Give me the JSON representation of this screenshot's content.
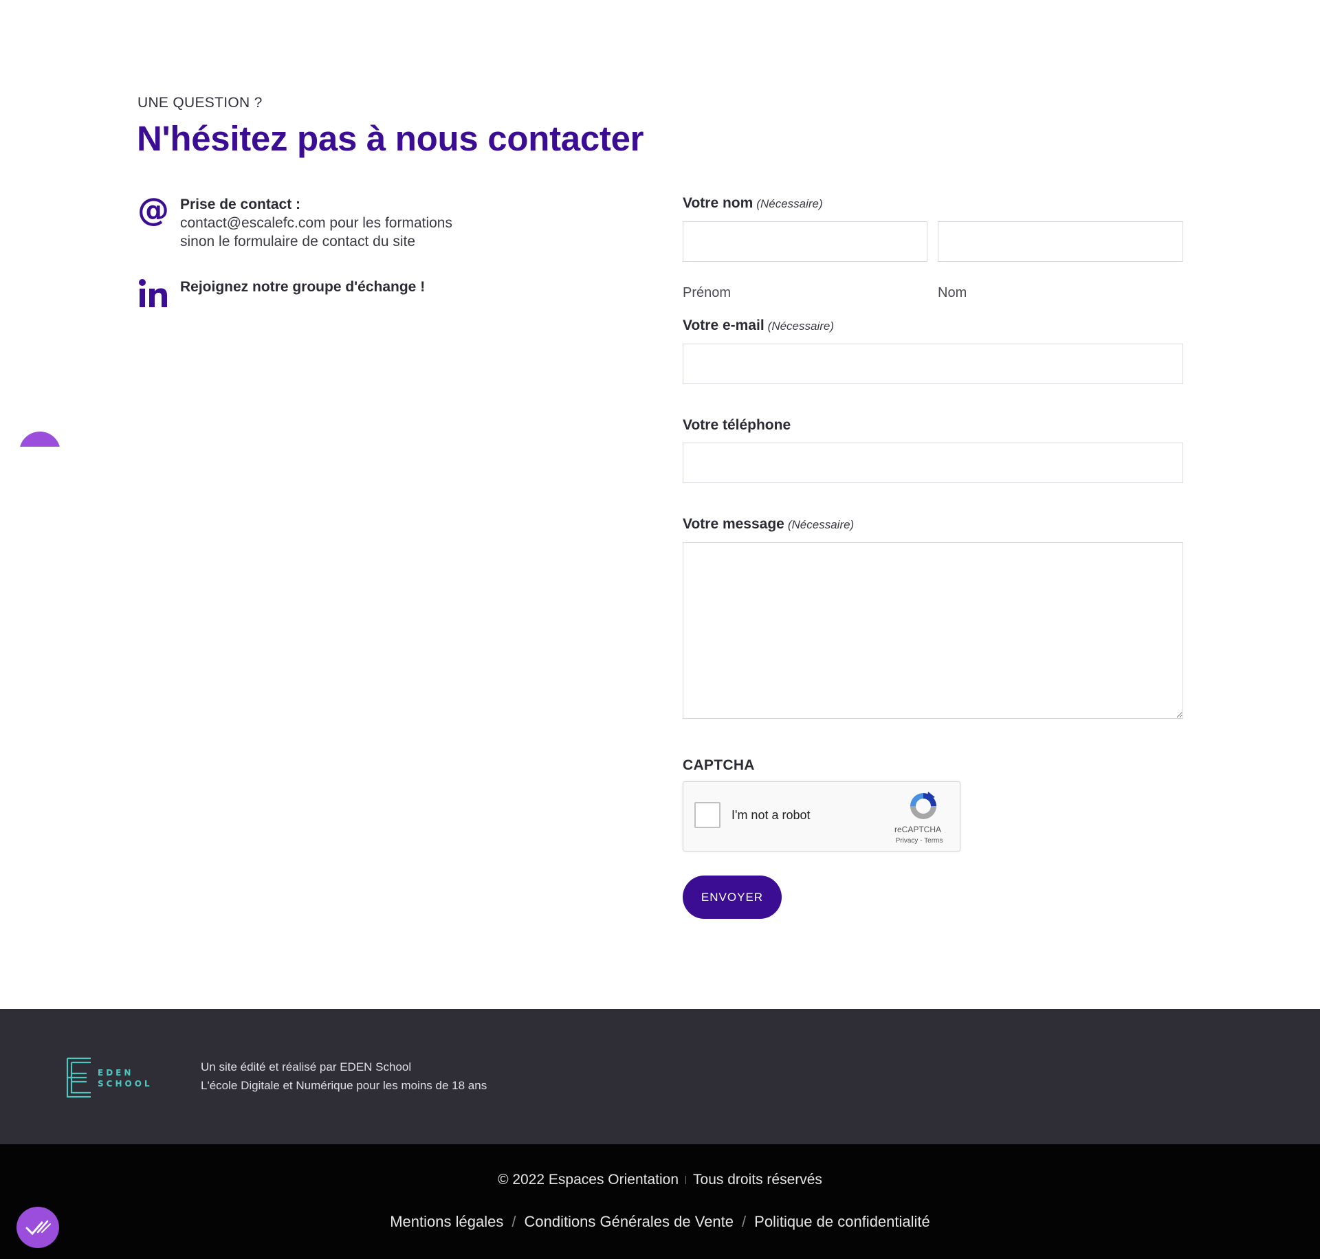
{
  "header": {
    "eyebrow": "UNE QUESTION ?",
    "title": "N'hésitez pas à nous contacter"
  },
  "contact_info": {
    "email_title": "Prise de contact :",
    "email_line1": "contact@escalefc.com pour les formations",
    "email_line2": "sinon le formulaire de contact du site",
    "linkedin_text": "Rejoignez notre groupe d'échange !"
  },
  "form": {
    "name_label": "Votre nom",
    "required_marker": "(Nécessaire)",
    "first_name_sublabel": "Prénom",
    "last_name_sublabel": "Nom",
    "email_label": "Votre e-mail",
    "phone_label": "Votre téléphone",
    "message_label": "Votre message",
    "captcha_label": "CAPTCHA",
    "submit_label": "ENVOYER",
    "first_name_value": "",
    "last_name_value": "",
    "email_value": "",
    "phone_value": "",
    "message_value": ""
  },
  "recaptcha": {
    "checkbox_label": "I'm not a robot",
    "brand": "reCAPTCHA",
    "links": "Privacy - Terms"
  },
  "footer": {
    "logo_text_top": "EDEN",
    "logo_text_bottom": "SCHOOL",
    "line1": "Un site édité et réalisé par EDEN School",
    "line2": "L'école Digitale et Numérique pour les moins de 18 ans",
    "copyright": "© 2022 Espaces Orientation",
    "rights": "Tous droits réservés",
    "link_legal": "Mentions légales",
    "link_cgv": "Conditions Générales de Vente",
    "link_privacy": "Politique de confidentialité",
    "separator": "/"
  },
  "colors": {
    "brand": "#3b0d93",
    "accent": "#9b4ddb",
    "teal": "#4fc6c0",
    "footer_top": "#2f2d35",
    "footer_bottom": "#040404"
  }
}
